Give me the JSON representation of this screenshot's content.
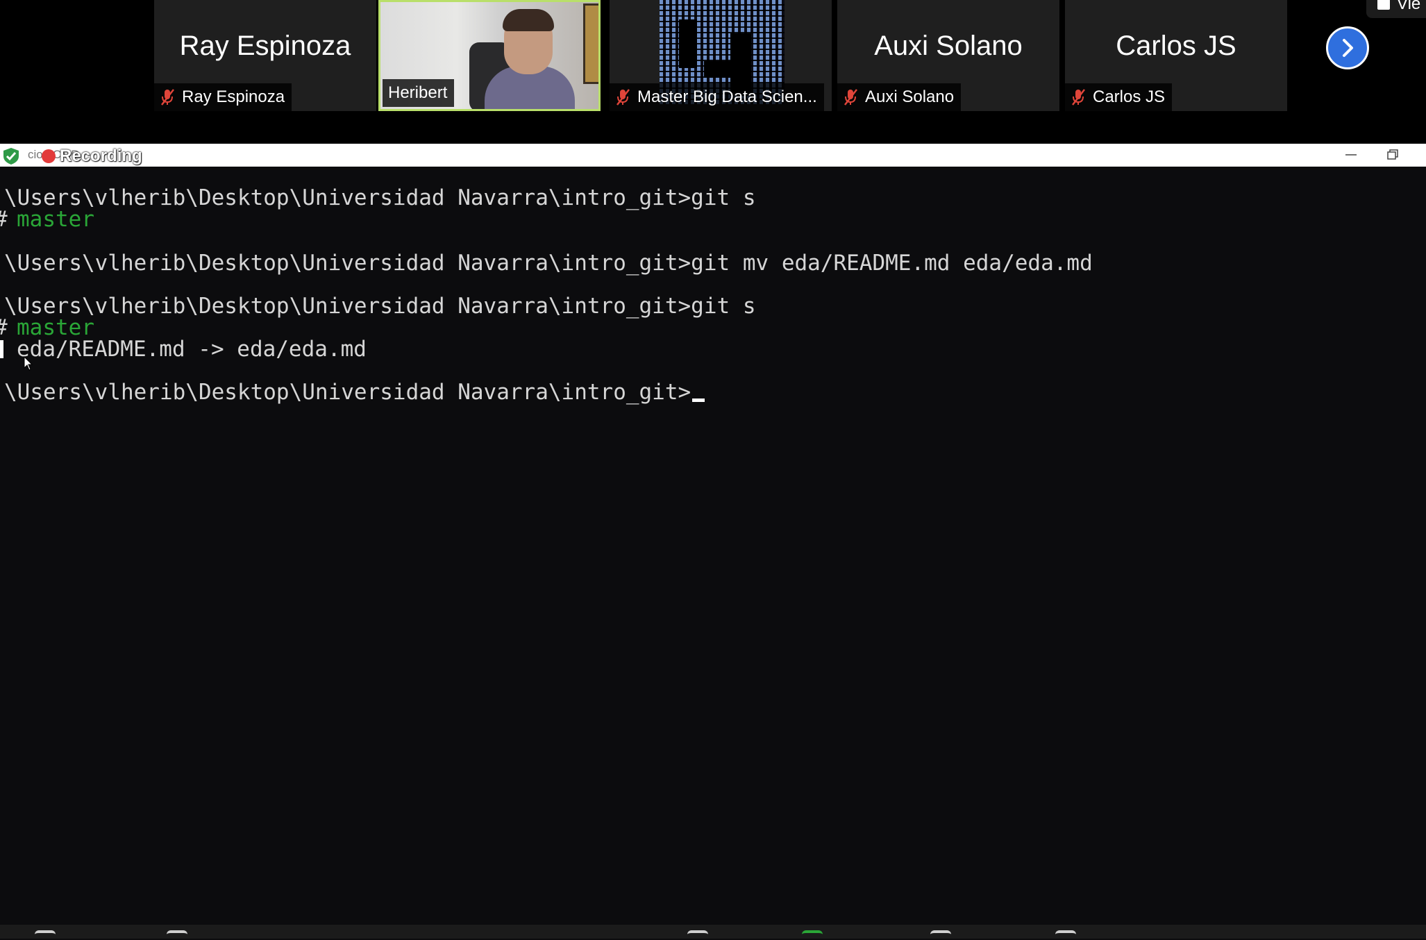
{
  "participants": [
    {
      "display_name": "Ray Espinoza",
      "tag": "Ray Espinoza",
      "muted": true,
      "video": false
    },
    {
      "display_name": "",
      "tag": "Heribert",
      "muted": false,
      "video": true,
      "active_speaker": true
    },
    {
      "display_name": "",
      "tag": "Master Big Data Scien...",
      "muted": true,
      "video": true
    },
    {
      "display_name": "Auxi Solano",
      "tag": "Auxi Solano",
      "muted": true,
      "video": false
    },
    {
      "display_name": "Carlos JS",
      "tag": "Carlos JS",
      "muted": true,
      "video": false
    }
  ],
  "view_button": {
    "label": "Vie"
  },
  "window": {
    "title": "cion CMD",
    "recording_label": "Recording"
  },
  "terminal": {
    "prompt": "\\Users\\vlherib\\Desktop\\Universidad Navarra\\intro_git>",
    "cmd1": "git s",
    "branch_marker": "#",
    "branch1": "master",
    "cmd2": "git mv eda/README.md eda/eda.md",
    "cmd3": "git s",
    "branch2": "master",
    "status_line": "eda/README.md -> eda/eda.md"
  },
  "icons": {
    "mic": "mic-muted-icon",
    "next": "chevron-right-icon",
    "shield": "shield-check-icon"
  },
  "colors": {
    "active_border": "#b9df6a",
    "next_button": "#2f6fde",
    "branch_text": "#2aa637",
    "record_dot": "#e23b3b"
  }
}
